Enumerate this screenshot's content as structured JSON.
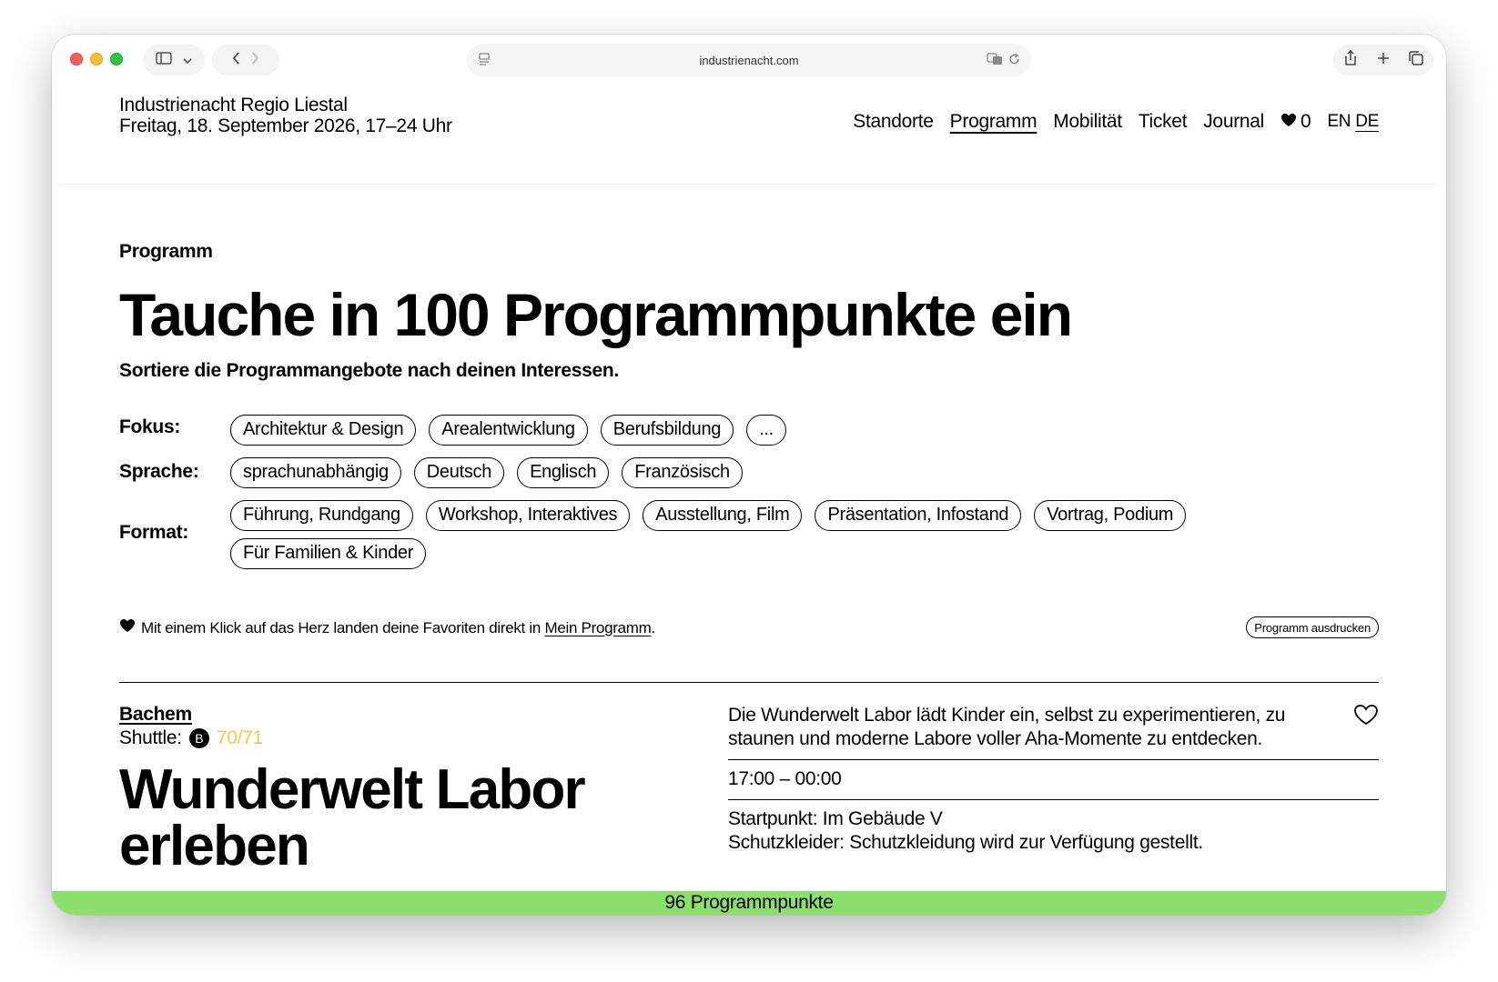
{
  "browser": {
    "url": "industrienacht.com"
  },
  "site": {
    "brand_line1": "Industrienacht Regio Liestal",
    "brand_line2": "Freitag, 18. September 2026, 17–24 Uhr",
    "nav": [
      "Standorte",
      "Programm",
      "Mobilität",
      "Ticket",
      "Journal"
    ],
    "favorites_count": "0",
    "lang_en": "EN",
    "lang_de": "DE"
  },
  "page": {
    "eyebrow": "Programm",
    "headline": "Tauche in 100 Programmpunkte ein",
    "subline": "Sortiere die Programmangebote nach deinen Interessen.",
    "filters": {
      "fokus_label": "Fokus:",
      "fokus": [
        "Architektur & Design",
        "Arealentwicklung",
        "Berufsbildung",
        "..."
      ],
      "sprache_label": "Sprache:",
      "sprache": [
        "sprachunabhängig",
        "Deutsch",
        "Englisch",
        "Französisch"
      ],
      "format_label": "Format:",
      "format": [
        "Führung, Rundgang",
        "Workshop, Interaktives",
        "Ausstellung, Film",
        "Präsentation, Infostand",
        "Vortrag, Podium",
        "Für Familien & Kinder"
      ]
    },
    "fav_hint_text": "Mit einem Klick auf das Herz landen deine Favoriten direkt in ",
    "fav_hint_link": "Mein Programm",
    "fav_hint_end": ".",
    "print_button": "Programm ausdrucken"
  },
  "entry": {
    "location": "Bachem",
    "shuttle_label": "Shuttle:",
    "shuttle_badge": "B",
    "shuttle_lines": "70/71",
    "title_line1": "Wunderwelt Labor",
    "title_line2": "erleben",
    "description": "Die Wunderwelt Labor lädt Kinder ein, selbst zu experimentieren, zu staunen und moderne Labore voller Aha-Momente zu entdecken.",
    "time": "17:00 – 00:00",
    "startpoint": "Startpunkt: Im Gebäude V",
    "protective": "Schutzkleider: Schutzkleidung wird zur Verfügung gestellt."
  },
  "footer": {
    "count_text": "96 Programmpunkte"
  },
  "colors": {
    "accent_green": "#8ae06b",
    "shuttle_lines": "#f2c94c"
  }
}
